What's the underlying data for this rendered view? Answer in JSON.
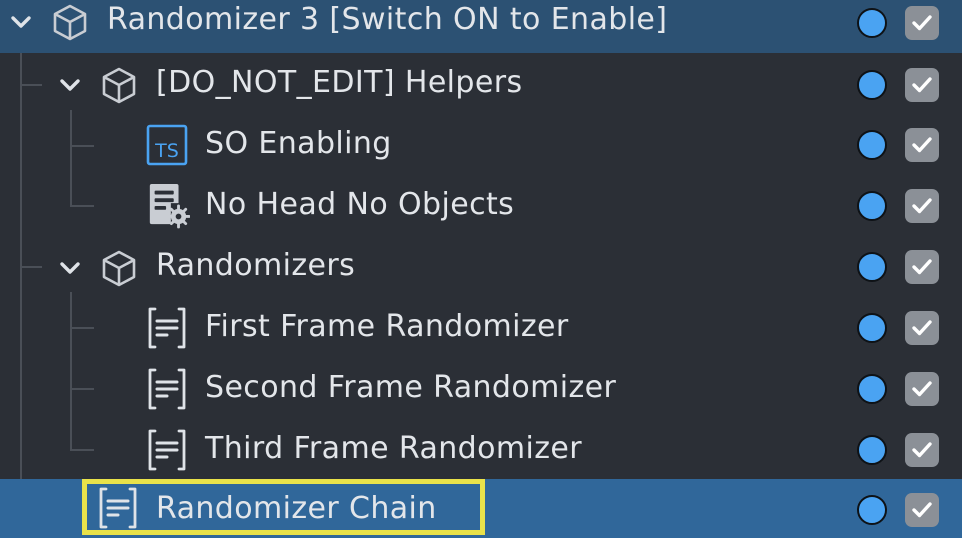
{
  "tree": {
    "items": [
      {
        "label": "Randomizer 3 [Switch ON to Enable]",
        "icon": "cube-icon",
        "expanded": true
      },
      {
        "label": "[DO_NOT_EDIT] Helpers",
        "icon": "cube-icon",
        "expanded": true
      },
      {
        "label": "SO Enabling",
        "icon": "typescript-file-icon"
      },
      {
        "label": "No Head No Objects",
        "icon": "config-file-icon"
      },
      {
        "label": "Randomizers",
        "icon": "cube-icon",
        "expanded": true
      },
      {
        "label": "First Frame Randomizer",
        "icon": "script-doc-icon"
      },
      {
        "label": "Second Frame Randomizer",
        "icon": "script-doc-icon"
      },
      {
        "label": "Third Frame Randomizer",
        "icon": "script-doc-icon"
      },
      {
        "label": "Randomizer Chain",
        "icon": "script-doc-icon",
        "selected": true,
        "highlighted": true
      }
    ],
    "ts_badge": "TS"
  },
  "colors": {
    "background": "#2b2f36",
    "selection_top": "#2c5173",
    "selection_bottom": "#30679a",
    "visibility_dot": "#4aa3f2",
    "checkbox": "#8b9097",
    "highlight": "#e9e24a"
  }
}
